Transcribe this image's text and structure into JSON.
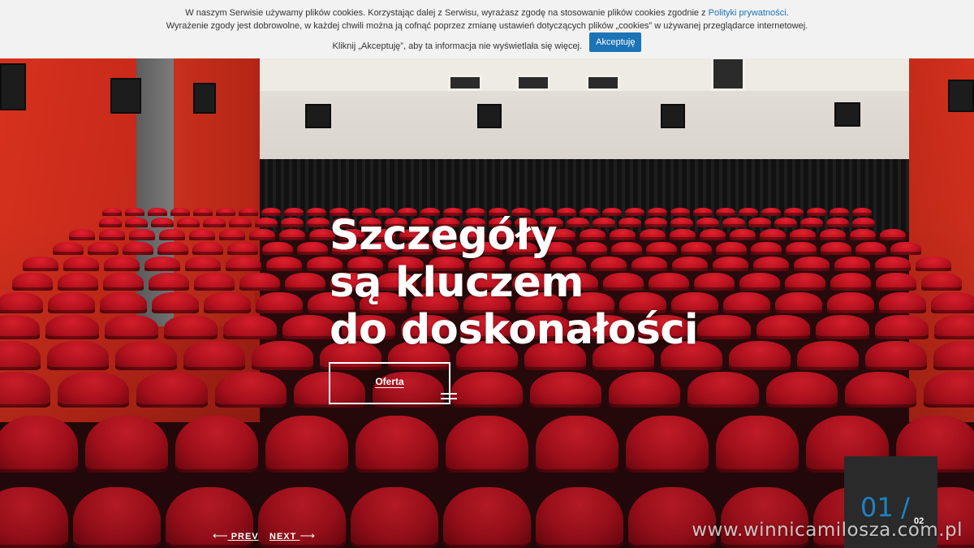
{
  "cookie": {
    "line1_prefix": "W naszym Serwisie używamy plików cookies. Korzystając dalej z Serwisu, wyrażasz zgodę na stosowanie plików cookies zgodnie z ",
    "policy_link": "Polityki prywatności",
    "line1_suffix": ".",
    "line2": "Wyrażenie zgody jest dobrowolne, w każdej chwili można ją cofnąć poprzez zmianę ustawień dotyczących plików „cookies” w używanej przeglądarce internetowej.",
    "line3": "Kliknij „Akceptuję”, aby ta informacja nie wyświetlała się więcej.",
    "accept_label": "Akceptuję"
  },
  "hero": {
    "headline": [
      "Szczegóły",
      "są kluczem",
      "do doskonałości"
    ],
    "offer_label": "Oferta"
  },
  "slider": {
    "prev_label": "PREV",
    "next_label": "NEXT",
    "prev_icon": "arrow-left-icon",
    "next_icon": "arrow-right-icon",
    "current": "01",
    "separator": "/",
    "total": "02"
  },
  "watermark": "www.winnicamilosza.com.pl",
  "colors": {
    "accent": "#1c73b5",
    "counter_accent": "#1d82c4",
    "seat_red": "#c01220",
    "wall_red": "#d8321f"
  }
}
